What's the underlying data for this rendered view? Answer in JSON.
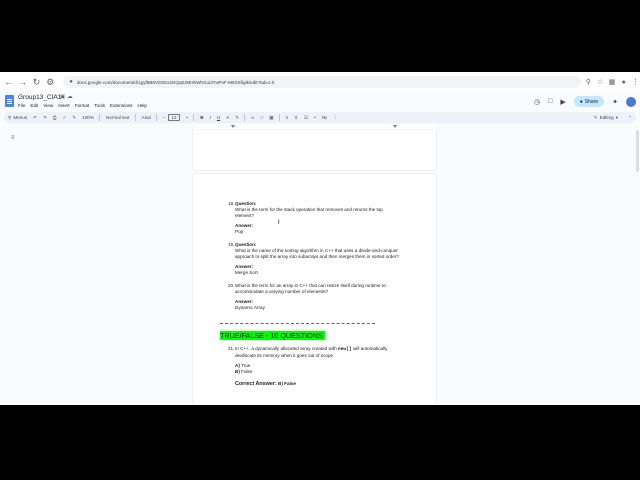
{
  "browser": {
    "url": "docs.google.com/document/d/1gyf8B8V0O514GQq0JMHhWhGui37wPvF-M6SSfigik/edit?tab=t.0"
  },
  "doc": {
    "title": "Group13_CIA1",
    "menus": [
      "File",
      "Edit",
      "View",
      "Insert",
      "Format",
      "Tools",
      "Extensions",
      "Help"
    ],
    "share_label": "Share"
  },
  "toolbar": {
    "search_label": "Menus",
    "zoom": "100%",
    "style": "Normal text",
    "font": "Arial",
    "font_size": "12",
    "mode": "Editing"
  },
  "content": {
    "q18": {
      "num": "18.",
      "label": "Question:",
      "line1": "What is the term for the stack operation that removes and returns the top",
      "line2": "element?",
      "answer_label": "Answer:",
      "answer": "Pop"
    },
    "q19": {
      "num": "19.",
      "label": "Question:",
      "line1": "What is the name of the sorting algorithm in C++ that uses a divide-and-conquer",
      "line2": "approach to split the array into subarrays and then merges them in sorted order?",
      "answer_label": "Answer:",
      "answer": "Merge Sort"
    },
    "q20": {
      "num": "20.",
      "line1": "What is the term for an array in C++ that can resize itself during runtime to",
      "line2": "accommodate a varying number of elements?",
      "answer_label": "Answer:",
      "answer": "Dynamic Array"
    },
    "tf_heading": "TRUE/FALSE - 10 QUESTIONS",
    "q21": {
      "num": "21.",
      "line1_pre": "In C++, a dynamically allocated array created with ",
      "line1_code": "new[]",
      "line1_post": " will automatically",
      "line2": "deallocate its memory when it goes out of scope",
      "opt_a_key": "A)",
      "opt_a": "True",
      "opt_b_key": "B)",
      "opt_b": "False",
      "correct_label": "Correct Answer:",
      "correct_value": "B) False"
    }
  }
}
